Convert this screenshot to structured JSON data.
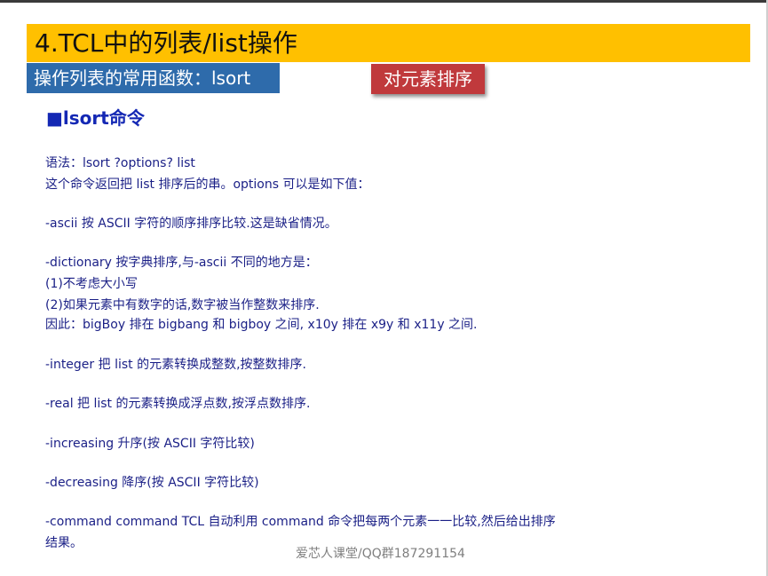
{
  "slide": {
    "title": "4.TCL中的列表/list操作",
    "subtitle": "操作列表的常用函数：lsort",
    "tag": "对元素排序",
    "heading": "■lsort命令",
    "lines": [
      "语法：lsort ?options? list",
      "这个命令返回把 list 排序后的串。options 可以是如下值：",
      "-ascii  按 ASCII 字符的顺序排序比较.这是缺省情况。",
      "-dictionary  按字典排序,与-ascii 不同的地方是：",
      "(1)不考虑大小写",
      "(2)如果元素中有数字的话,数字被当作整数来排序.",
      "因此：bigBoy 排在 bigbang 和 bigboy 之间, x10y  排在 x9y 和 x11y 之间.",
      "-integer  把 list 的元素转换成整数,按整数排序.",
      "-real  把 list 的元素转换成浮点数,按浮点数排序.",
      "-increasing  升序(按 ASCII 字符比较)",
      "-decreasing  降序(按 ASCII 字符比较)",
      "-command command TCL 自动利用 command  命令把每两个元素一一比较,然后给出排序",
      "结果。"
    ],
    "footer": "爱芯人课堂/QQ群187291154"
  }
}
